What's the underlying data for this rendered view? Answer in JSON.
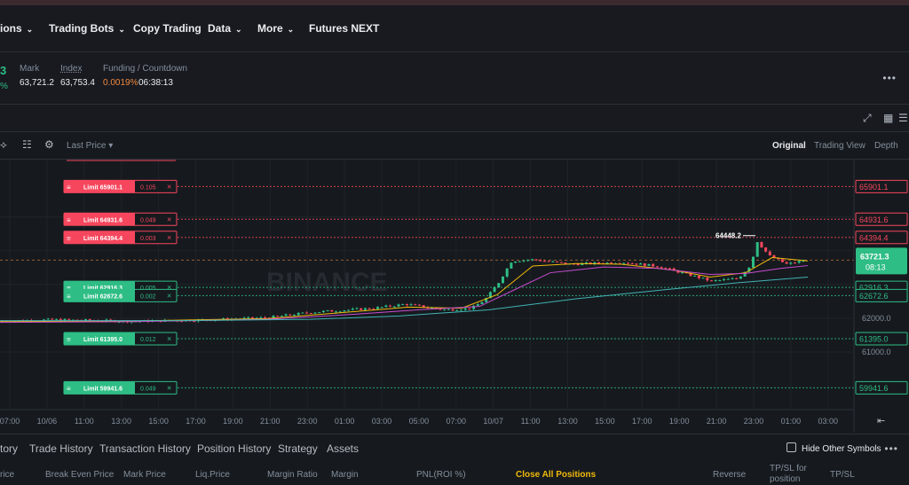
{
  "nav": {
    "items": [
      {
        "label": "ions",
        "dropdown": true
      },
      {
        "label": "Trading Bots",
        "dropdown": true
      },
      {
        "label": "Copy Trading",
        "dropdown": false
      },
      {
        "label": "Data",
        "dropdown": true
      },
      {
        "label": "More",
        "dropdown": true
      },
      {
        "label": "Futures NEXT",
        "dropdown": false
      }
    ]
  },
  "ticker": {
    "price_fragment": "3",
    "change_fragment": "%",
    "mark_label": "Mark",
    "mark_value": "63,721.2",
    "index_label": "Index",
    "index_value": "63,753.4",
    "funding_label": "Funding / Countdown",
    "funding_rate": "0.0019%",
    "countdown": "06:38:13",
    "more_icon": "more-horizontal-icon"
  },
  "chart_toolbar": {
    "price_source": "Last Price",
    "views": [
      "Original",
      "Trading View",
      "Depth"
    ],
    "active_view": "Original"
  },
  "chart": {
    "watermark": "BINANCE",
    "peak_label": "64448.2",
    "current_price": "63721.3",
    "countdown": "08:13",
    "axis_labels": [
      "62000.0",
      "61000.0"
    ],
    "orders": [
      {
        "side": "sell",
        "label": "Limit 65901.1",
        "qty": "0.105",
        "price": "65901.1"
      },
      {
        "side": "sell",
        "label": "Limit 64931.6",
        "qty": "0.049",
        "price": "64931.6"
      },
      {
        "side": "sell",
        "label": "Limit 64394.4",
        "qty": "0.003",
        "price": "64394.4"
      },
      {
        "side": "buy",
        "label": "Limit 62916.3",
        "qty": "0.005",
        "price": "62916.3"
      },
      {
        "side": "buy",
        "label": "Limit 62672.6",
        "qty": "0.002",
        "price": "62672.6"
      },
      {
        "side": "buy",
        "label": "Limit 61395.0",
        "qty": "0.012",
        "price": "61395.0"
      },
      {
        "side": "buy",
        "label": "Limit 59941.6",
        "qty": "0.049",
        "price": "59941.6"
      }
    ],
    "time_labels": [
      "07:00",
      "10/06",
      "11:00",
      "13:00",
      "15:00",
      "17:00",
      "19:00",
      "21:00",
      "23:00",
      "01:00",
      "03:00",
      "05:00",
      "07:00",
      "10/07",
      "11:00",
      "13:00",
      "15:00",
      "17:00",
      "19:00",
      "21:00",
      "23:00",
      "01:00",
      "03:00"
    ],
    "colors": {
      "up": "#2ebd85",
      "down": "#f6465d",
      "ma1": "#f0b90b",
      "ma2": "#c74bd1",
      "ma3": "#41b3b5"
    }
  },
  "bottom_tabs": {
    "tabs": [
      "tory",
      "Trade History",
      "Transaction History",
      "Position History",
      "Strategy",
      "Assets"
    ],
    "hide_other": "Hide Other Symbols"
  },
  "columns": {
    "headers": [
      "rice",
      "Break Even Price",
      "Mark Price",
      "Liq.Price",
      "Margin Ratio",
      "Margin",
      "PNL(ROI %)",
      "Close All Positions",
      "Reverse",
      "TP/SL for position",
      "TP/SL"
    ]
  }
}
